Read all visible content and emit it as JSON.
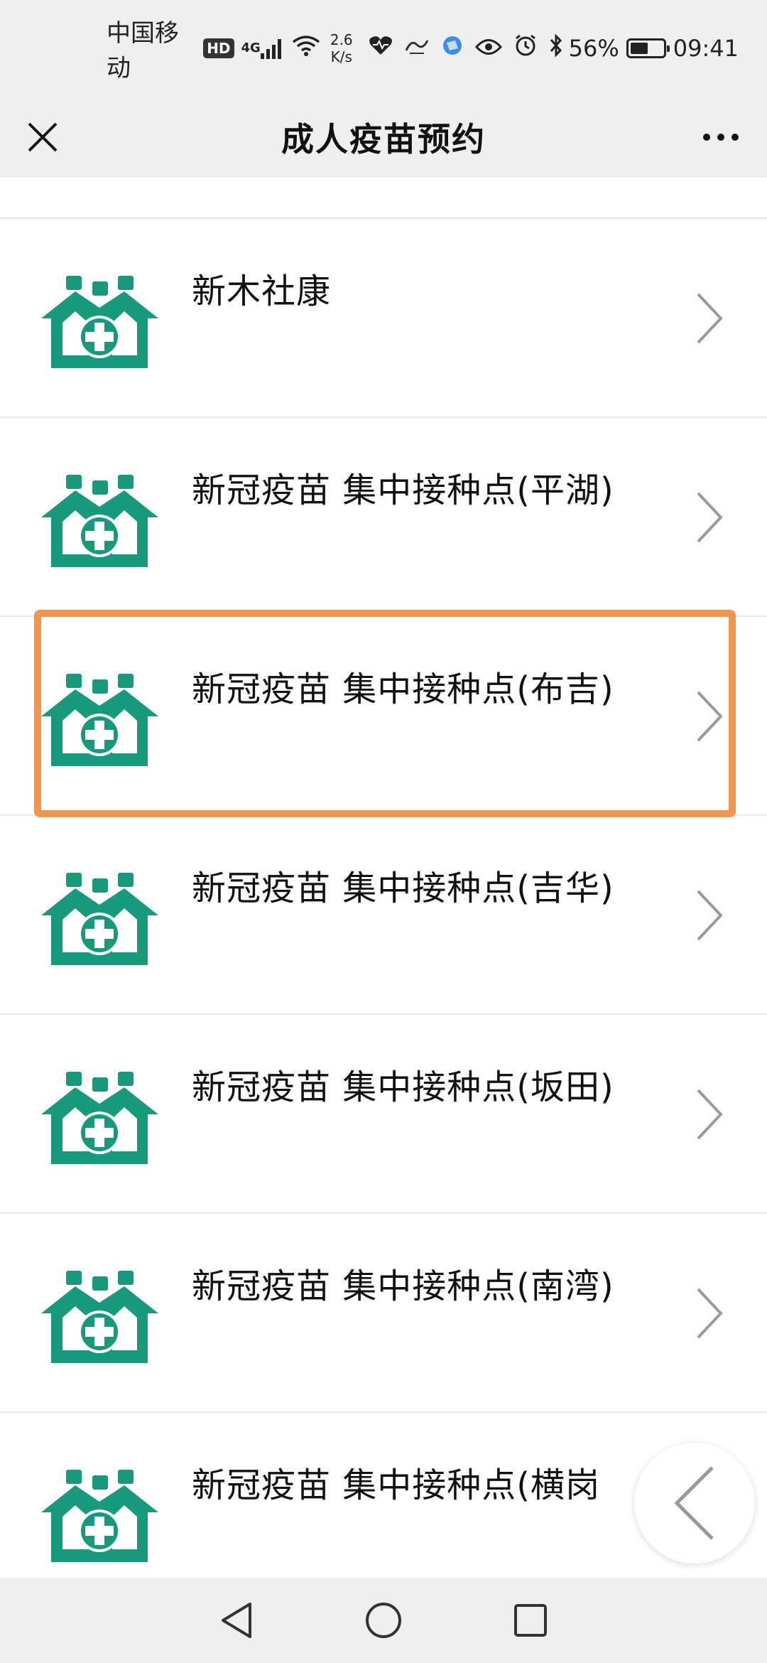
{
  "status_bar": {
    "carrier": "中国移动",
    "hd": "HD",
    "network": "4G",
    "speed_value": "2.6",
    "speed_unit": "K/s",
    "battery": "56%",
    "battery_level": 0.56,
    "time": "09:41"
  },
  "header": {
    "title": "成人疫苗预约"
  },
  "list": {
    "items": [
      {
        "name": "新木社康"
      },
      {
        "name": "新冠疫苗 集中接种点(平湖)"
      },
      {
        "name": "新冠疫苗 集中接种点(布吉)"
      },
      {
        "name": "新冠疫苗 集中接种点(吉华)"
      },
      {
        "name": "新冠疫苗 集中接种点(坂田)"
      },
      {
        "name": "新冠疫苗 集中接种点(南湾)"
      },
      {
        "name": "新冠疫苗 集中接种点(横岗"
      }
    ],
    "highlighted_index": 2
  },
  "colors": {
    "logo_green": "#17997b",
    "highlight_orange": "#f0964e",
    "chevron_gray": "#9a9a9a"
  }
}
